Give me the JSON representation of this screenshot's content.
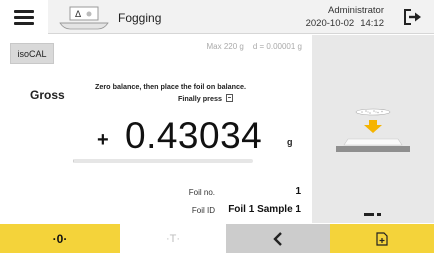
{
  "header": {
    "menu_icon": "hamburger-icon",
    "app_icon": "balance-delta-icon",
    "app_title": "Fogging",
    "user": "Administrator",
    "date": "2020-10-02",
    "time": "14:12",
    "logout_icon": "logout-icon"
  },
  "main": {
    "isocal_label": "isoCAL",
    "capacity_max": "Max 220 g",
    "capacity_d": "d = 0.00001 g",
    "weighing_mode": "Gross",
    "instruction_line1": "Zero balance, then place the foil on balance.",
    "instruction_line2": "Finally press",
    "sign": "+",
    "reading": "0.43034",
    "unit": "g",
    "capacity_used_fraction": 0.002,
    "foil_no_label": "Foil no.",
    "foil_no_value": "1",
    "foil_id_label": "Foil ID",
    "foil_id_value": "Foil 1 Sample 1"
  },
  "side_panel": {
    "illustration": "place-foil-on-pan-illustration",
    "page_count": 2,
    "current_page": 1
  },
  "bottom_bar": {
    "zero_label": "·0·",
    "tare_label": "·T·",
    "back_icon": "chevron-left-icon",
    "print_icon": "print-document-icon"
  },
  "colors": {
    "accent_yellow": "#f4d33a",
    "arrow_orange": "#f5b400",
    "topbar_bg": "#f2f2f2",
    "side_panel_bg": "#e8e8e8",
    "back_button_bg": "#cccccc"
  }
}
